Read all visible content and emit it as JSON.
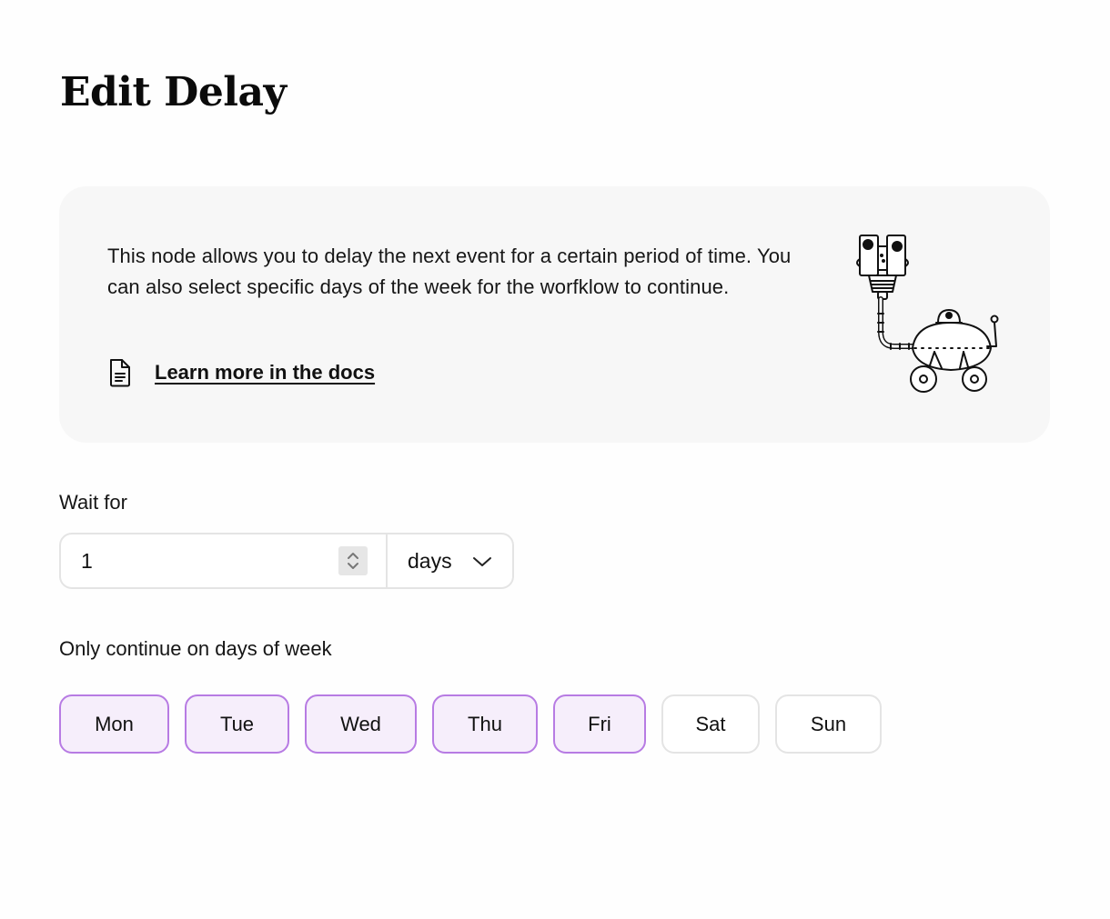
{
  "page": {
    "title": "Edit Delay"
  },
  "info": {
    "description": "This node allows you to delay the next event for a certain period of time. You can also select specific days of the week for the worfklow to continue.",
    "docs_link": "Learn more in the docs",
    "docs_icon": "document-icon",
    "illustration": "robot-illustration"
  },
  "wait": {
    "label": "Wait for",
    "value": "1",
    "unit": "days"
  },
  "weekdays": {
    "label": "Only continue on days of week",
    "accent_color": "#b77be3",
    "selected_background": "#f6eefb",
    "days": [
      {
        "label": "Mon",
        "selected": true
      },
      {
        "label": "Tue",
        "selected": true
      },
      {
        "label": "Wed",
        "selected": true
      },
      {
        "label": "Thu",
        "selected": true
      },
      {
        "label": "Fri",
        "selected": true
      },
      {
        "label": "Sat",
        "selected": false
      },
      {
        "label": "Sun",
        "selected": false
      }
    ]
  }
}
